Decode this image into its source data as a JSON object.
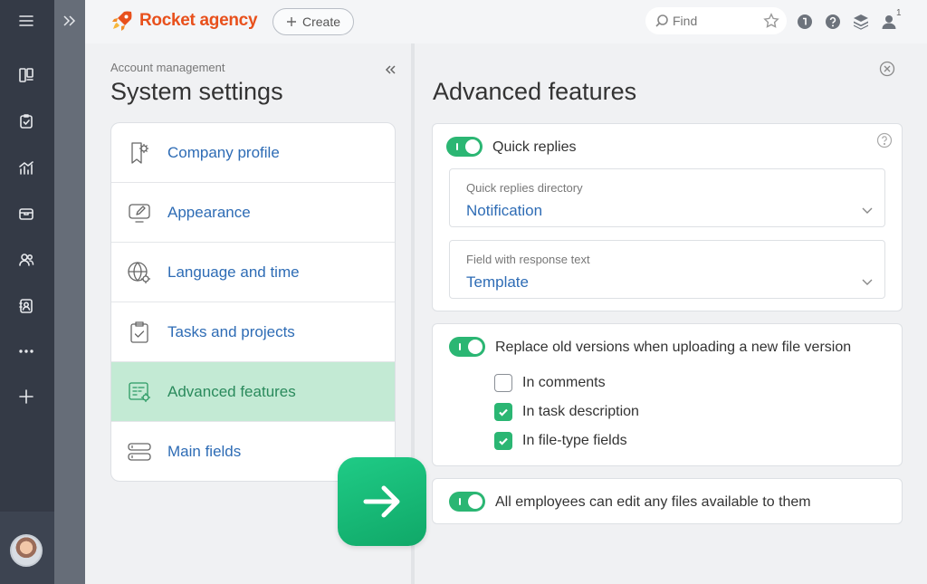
{
  "topbar": {
    "logo_text": "Rocket agency",
    "create_label": "Create",
    "search_placeholder": "Find",
    "notification_count": "1"
  },
  "left": {
    "breadcrumb": "Account management",
    "title": "System settings",
    "items": [
      {
        "label": "Company profile",
        "icon": "badge-gear-icon"
      },
      {
        "label": "Appearance",
        "icon": "monitor-pencil-icon"
      },
      {
        "label": "Language and time",
        "icon": "globe-gear-icon"
      },
      {
        "label": "Tasks and projects",
        "icon": "clipboard-check-icon"
      },
      {
        "label": "Advanced features",
        "icon": "form-gear-icon",
        "active": true
      },
      {
        "label": "Main fields",
        "icon": "fields-icon"
      }
    ]
  },
  "right": {
    "title": "Advanced features",
    "quick_replies": {
      "label": "Quick replies",
      "enabled": true,
      "directory_label": "Quick replies directory",
      "directory_value": "Notification",
      "field_label": "Field with response text",
      "field_value": "Template"
    },
    "replace_versions": {
      "label": "Replace old versions when uploading a new file version",
      "enabled": true,
      "options": [
        {
          "label": "In comments",
          "checked": false
        },
        {
          "label": "In task description",
          "checked": true
        },
        {
          "label": "In file-type fields",
          "checked": true
        }
      ]
    },
    "edit_files": {
      "label": "All employees can edit any files available to them",
      "enabled": true
    }
  },
  "colors": {
    "accent_green": "#2bb673",
    "link_blue": "#2e6cb5",
    "logo_orange": "#e8501c",
    "active_menu_bg": "#c3ead4",
    "rail_dark": "#343a46"
  }
}
